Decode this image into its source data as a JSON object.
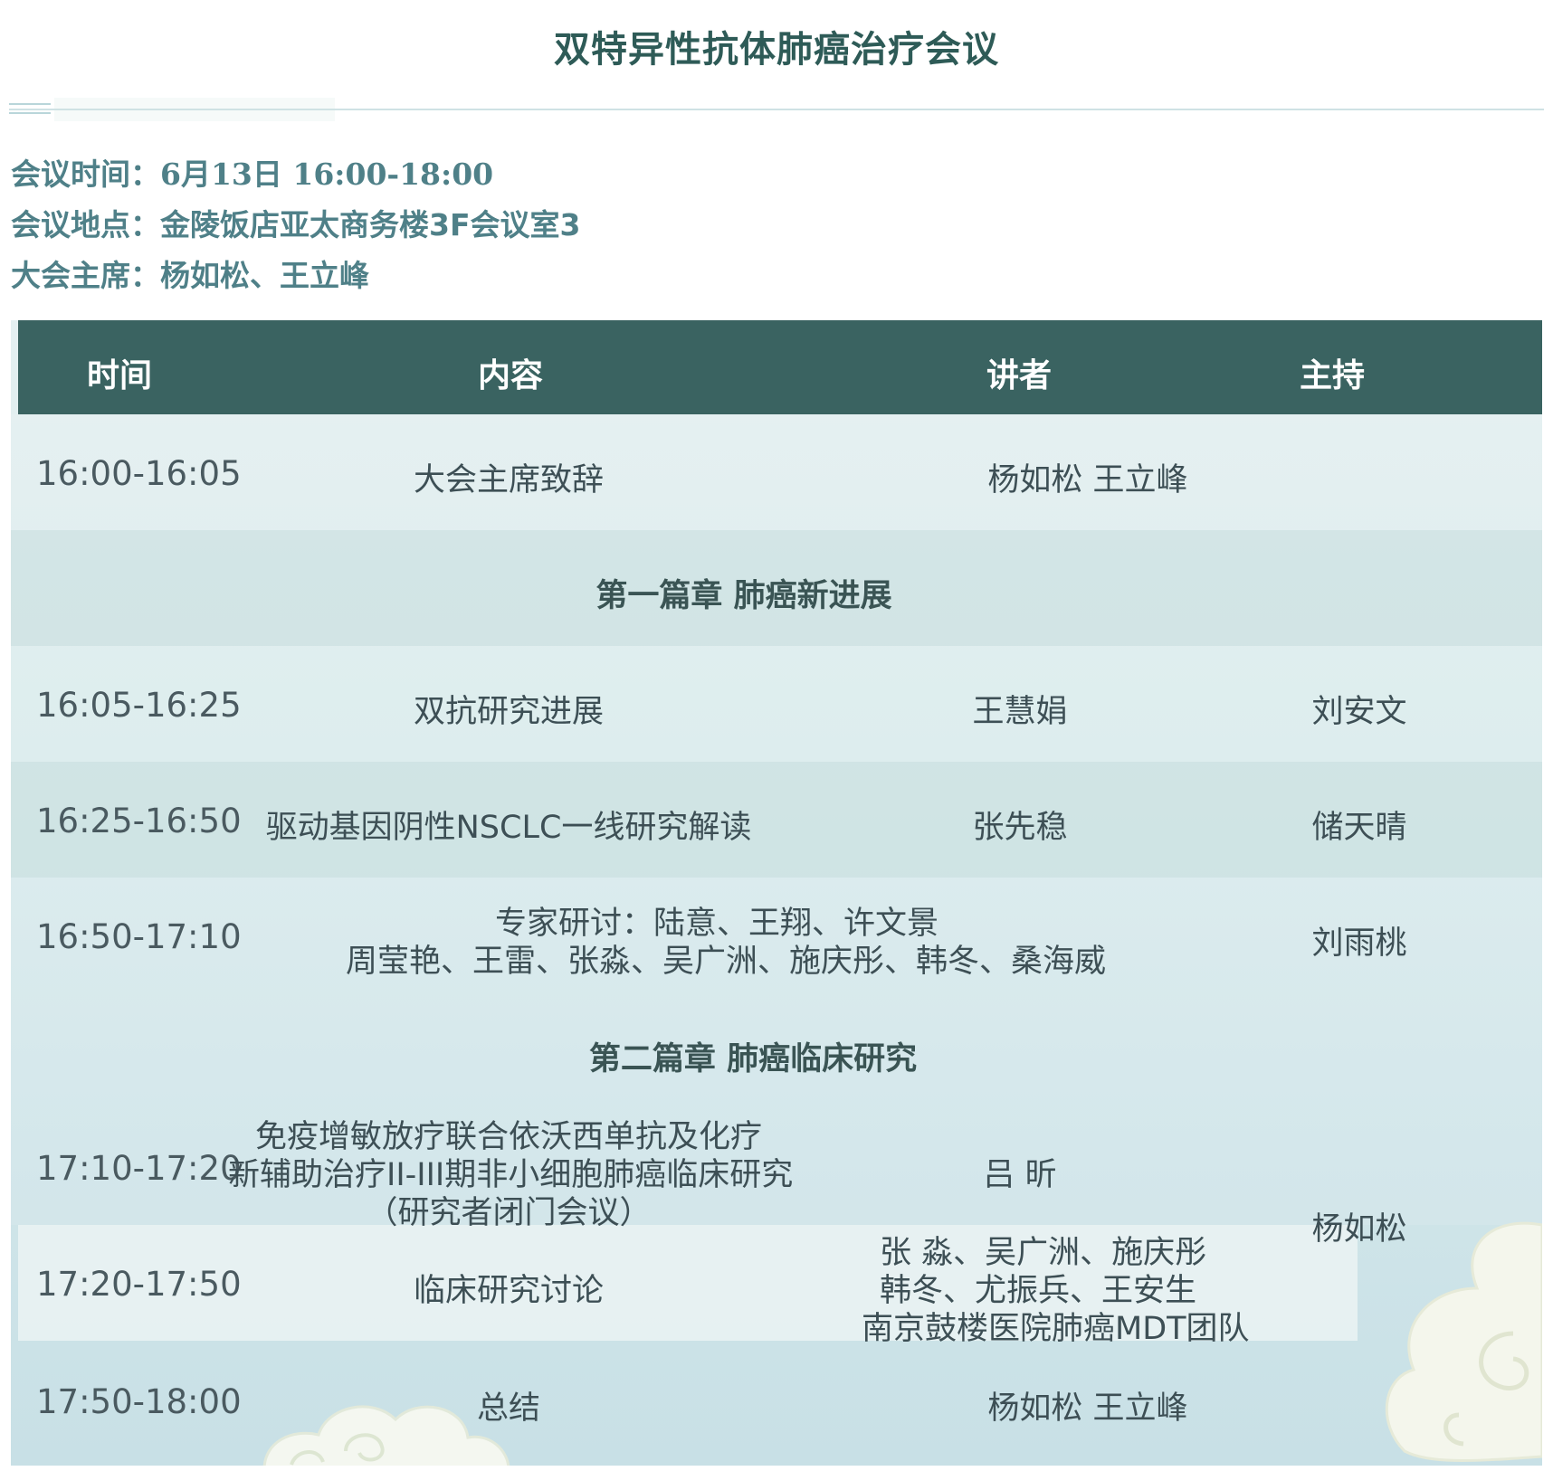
{
  "title": "双特异性抗体肺癌治疗会议",
  "info": [
    {
      "label": "会议时间：",
      "value": "6月13日 16:00-18:00"
    },
    {
      "label": "会议地点：",
      "value": "金陵饭店亚太商务楼3F会议室3"
    },
    {
      "label": "大会主席：",
      "value": "杨如松、王立峰"
    }
  ],
  "table": {
    "headers": {
      "time": "时间",
      "content": "内容",
      "speaker": "讲者",
      "host": "主持"
    },
    "rows": [
      {
        "time": "16:00-16:05",
        "content": "大会主席致辞",
        "speaker": "杨如松  王立峰"
      },
      {
        "chapter": "第一篇章 肺癌新进展"
      },
      {
        "time": "16:05-16:25",
        "content": "双抗研究进展",
        "speaker": "王慧娟",
        "host": "刘安文"
      },
      {
        "time": "16:25-16:50",
        "content": "驱动基因阴性NSCLC一线研究解读",
        "speaker": "张先稳",
        "host": "储天晴"
      },
      {
        "time": "16:50-17:10",
        "content_lines": [
          "专家研讨：陆意、王翔、许文景",
          "周莹艳、王雷、张淼、吴广洲、施庆彤、韩冬、桑海威"
        ],
        "host": "刘雨桃"
      },
      {
        "chapter": "第二篇章 肺癌临床研究"
      },
      {
        "time": "17:10-17:20",
        "content_lines": [
          "免疫增敏放疗联合依沃西单抗及化疗",
          "新辅助治疗II-III期非小细胞肺癌临床研究",
          "（研究者闭门会议）"
        ],
        "speaker": "吕 昕"
      },
      {
        "time": "17:20-17:50",
        "content": "临床研究讨论",
        "speaker_lines": [
          "张 淼、吴广洲、施庆彤",
          "韩冬、尤振兵、王安生",
          "南京鼓楼医院肺癌MDT团队"
        ]
      },
      {
        "time": "17:50-18:00",
        "content": "总结",
        "speaker": "杨如松  王立峰"
      }
    ],
    "shared_host": "杨如松"
  },
  "colors": {
    "header_bg": "#3a6361",
    "title": "#2e5b57",
    "info": "#4f8088"
  }
}
